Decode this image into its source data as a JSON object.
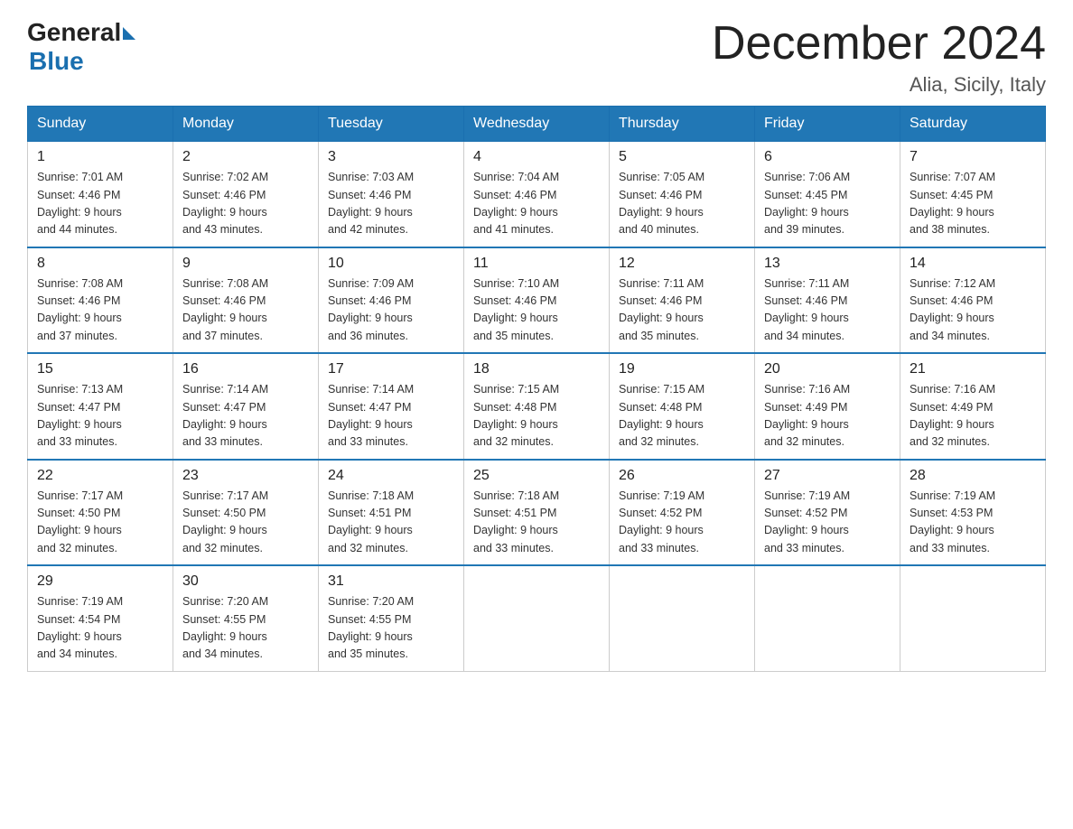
{
  "header": {
    "logo_general": "General",
    "logo_blue": "Blue",
    "month_title": "December 2024",
    "location": "Alia, Sicily, Italy"
  },
  "days_of_week": [
    "Sunday",
    "Monday",
    "Tuesday",
    "Wednesday",
    "Thursday",
    "Friday",
    "Saturday"
  ],
  "weeks": [
    [
      {
        "day": "1",
        "sunrise": "7:01 AM",
        "sunset": "4:46 PM",
        "daylight": "9 hours and 44 minutes."
      },
      {
        "day": "2",
        "sunrise": "7:02 AM",
        "sunset": "4:46 PM",
        "daylight": "9 hours and 43 minutes."
      },
      {
        "day": "3",
        "sunrise": "7:03 AM",
        "sunset": "4:46 PM",
        "daylight": "9 hours and 42 minutes."
      },
      {
        "day": "4",
        "sunrise": "7:04 AM",
        "sunset": "4:46 PM",
        "daylight": "9 hours and 41 minutes."
      },
      {
        "day": "5",
        "sunrise": "7:05 AM",
        "sunset": "4:46 PM",
        "daylight": "9 hours and 40 minutes."
      },
      {
        "day": "6",
        "sunrise": "7:06 AM",
        "sunset": "4:45 PM",
        "daylight": "9 hours and 39 minutes."
      },
      {
        "day": "7",
        "sunrise": "7:07 AM",
        "sunset": "4:45 PM",
        "daylight": "9 hours and 38 minutes."
      }
    ],
    [
      {
        "day": "8",
        "sunrise": "7:08 AM",
        "sunset": "4:46 PM",
        "daylight": "9 hours and 37 minutes."
      },
      {
        "day": "9",
        "sunrise": "7:08 AM",
        "sunset": "4:46 PM",
        "daylight": "9 hours and 37 minutes."
      },
      {
        "day": "10",
        "sunrise": "7:09 AM",
        "sunset": "4:46 PM",
        "daylight": "9 hours and 36 minutes."
      },
      {
        "day": "11",
        "sunrise": "7:10 AM",
        "sunset": "4:46 PM",
        "daylight": "9 hours and 35 minutes."
      },
      {
        "day": "12",
        "sunrise": "7:11 AM",
        "sunset": "4:46 PM",
        "daylight": "9 hours and 35 minutes."
      },
      {
        "day": "13",
        "sunrise": "7:11 AM",
        "sunset": "4:46 PM",
        "daylight": "9 hours and 34 minutes."
      },
      {
        "day": "14",
        "sunrise": "7:12 AM",
        "sunset": "4:46 PM",
        "daylight": "9 hours and 34 minutes."
      }
    ],
    [
      {
        "day": "15",
        "sunrise": "7:13 AM",
        "sunset": "4:47 PM",
        "daylight": "9 hours and 33 minutes."
      },
      {
        "day": "16",
        "sunrise": "7:14 AM",
        "sunset": "4:47 PM",
        "daylight": "9 hours and 33 minutes."
      },
      {
        "day": "17",
        "sunrise": "7:14 AM",
        "sunset": "4:47 PM",
        "daylight": "9 hours and 33 minutes."
      },
      {
        "day": "18",
        "sunrise": "7:15 AM",
        "sunset": "4:48 PM",
        "daylight": "9 hours and 32 minutes."
      },
      {
        "day": "19",
        "sunrise": "7:15 AM",
        "sunset": "4:48 PM",
        "daylight": "9 hours and 32 minutes."
      },
      {
        "day": "20",
        "sunrise": "7:16 AM",
        "sunset": "4:49 PM",
        "daylight": "9 hours and 32 minutes."
      },
      {
        "day": "21",
        "sunrise": "7:16 AM",
        "sunset": "4:49 PM",
        "daylight": "9 hours and 32 minutes."
      }
    ],
    [
      {
        "day": "22",
        "sunrise": "7:17 AM",
        "sunset": "4:50 PM",
        "daylight": "9 hours and 32 minutes."
      },
      {
        "day": "23",
        "sunrise": "7:17 AM",
        "sunset": "4:50 PM",
        "daylight": "9 hours and 32 minutes."
      },
      {
        "day": "24",
        "sunrise": "7:18 AM",
        "sunset": "4:51 PM",
        "daylight": "9 hours and 32 minutes."
      },
      {
        "day": "25",
        "sunrise": "7:18 AM",
        "sunset": "4:51 PM",
        "daylight": "9 hours and 33 minutes."
      },
      {
        "day": "26",
        "sunrise": "7:19 AM",
        "sunset": "4:52 PM",
        "daylight": "9 hours and 33 minutes."
      },
      {
        "day": "27",
        "sunrise": "7:19 AM",
        "sunset": "4:52 PM",
        "daylight": "9 hours and 33 minutes."
      },
      {
        "day": "28",
        "sunrise": "7:19 AM",
        "sunset": "4:53 PM",
        "daylight": "9 hours and 33 minutes."
      }
    ],
    [
      {
        "day": "29",
        "sunrise": "7:19 AM",
        "sunset": "4:54 PM",
        "daylight": "9 hours and 34 minutes."
      },
      {
        "day": "30",
        "sunrise": "7:20 AM",
        "sunset": "4:55 PM",
        "daylight": "9 hours and 34 minutes."
      },
      {
        "day": "31",
        "sunrise": "7:20 AM",
        "sunset": "4:55 PM",
        "daylight": "9 hours and 35 minutes."
      },
      null,
      null,
      null,
      null
    ]
  ],
  "labels": {
    "sunrise": "Sunrise:",
    "sunset": "Sunset:",
    "daylight": "Daylight:"
  }
}
